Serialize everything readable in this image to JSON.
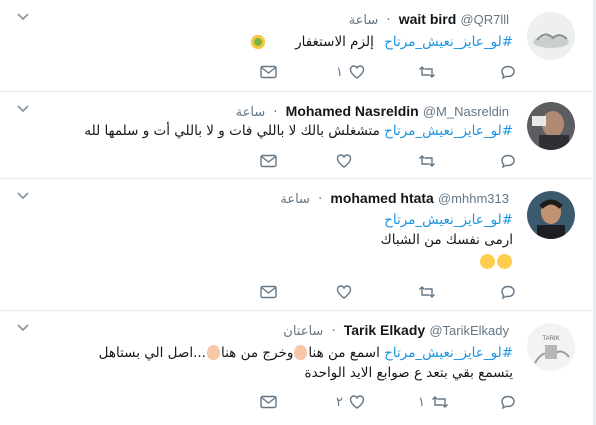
{
  "tweets": [
    {
      "name": "wait bird",
      "handle": "@QR7lll",
      "time": "ساعة",
      "hashtag": "#لو_عايز_نعيش_مرتاح",
      "text": "إلزم الاستغفار",
      "likes": "١",
      "retweets": "",
      "avatar_icon": "photo-thumbnail"
    },
    {
      "name": "Mohamed Nasreldin",
      "handle": "@M_Nasreldin",
      "time": "ساعة",
      "hashtag": "#لو_عايز_نعيش_مرتاح",
      "text": "متشغلش بالك لا باللي فات و لا باللي أت و سلمها لله",
      "likes": "",
      "retweets": "",
      "avatar_icon": "profile-photo"
    },
    {
      "name": "mohamed htata",
      "handle": "@mhhm313",
      "time": "ساعة",
      "hashtag": "#لو_عايز_نعيش_مرتاح",
      "text": "ارمى نفسك من الشباك",
      "likes": "",
      "retweets": "",
      "avatar_icon": "profile-photo"
    },
    {
      "name": "Tarik Elkady",
      "handle": "@TarikElkady",
      "time": "ساعتان",
      "hashtag": "#لو_عايز_نعيش_مرتاح",
      "line1_mid": "اسمع من هنا",
      "line1_mid2": "وخرج من هنا",
      "line1_end": "...اصل الي بستاهل",
      "line2": "يتسمع  بقي بتعد ع صوابع الايد الواحدة",
      "likes": "٢",
      "retweets": "١",
      "avatar_label": "TARIK"
    }
  ]
}
